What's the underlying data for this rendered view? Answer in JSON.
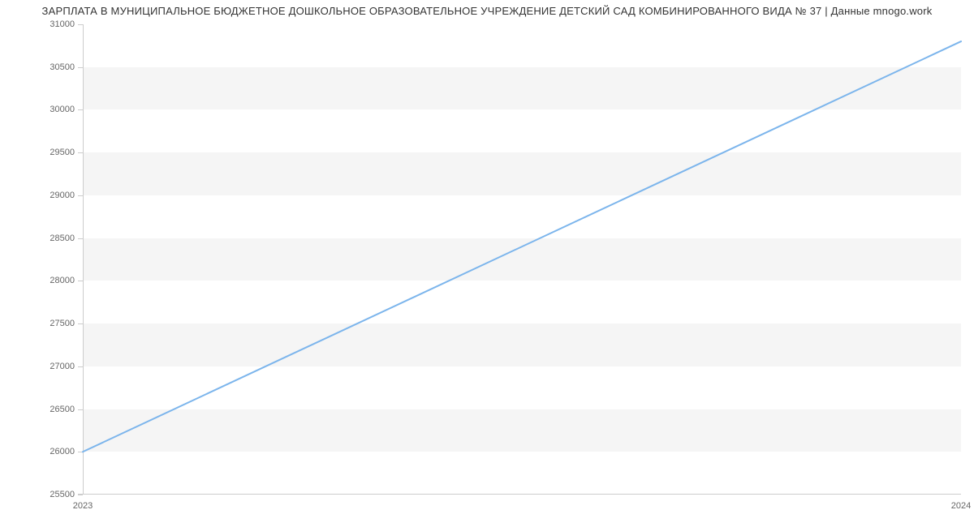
{
  "chart_data": {
    "type": "line",
    "title": "ЗАРПЛАТА В МУНИЦИПАЛЬНОЕ БЮДЖЕТНОЕ ДОШКОЛЬНОЕ ОБРАЗОВАТЕЛЬНОЕ УЧРЕЖДЕНИЕ ДЕТСКИЙ САД КОМБИНИРОВАННОГО ВИДА № 37 | Данные mnogo.work",
    "x": [
      2023,
      2024
    ],
    "values": [
      26000,
      30800
    ],
    "xlabel": "",
    "ylabel": "",
    "ylim": [
      25500,
      31000
    ],
    "y_ticks": [
      25500,
      26000,
      26500,
      27000,
      27500,
      28000,
      28500,
      29000,
      29500,
      30000,
      30500,
      31000
    ],
    "x_ticks": [
      2023,
      2024
    ],
    "line_color": "#7cb5ec"
  }
}
